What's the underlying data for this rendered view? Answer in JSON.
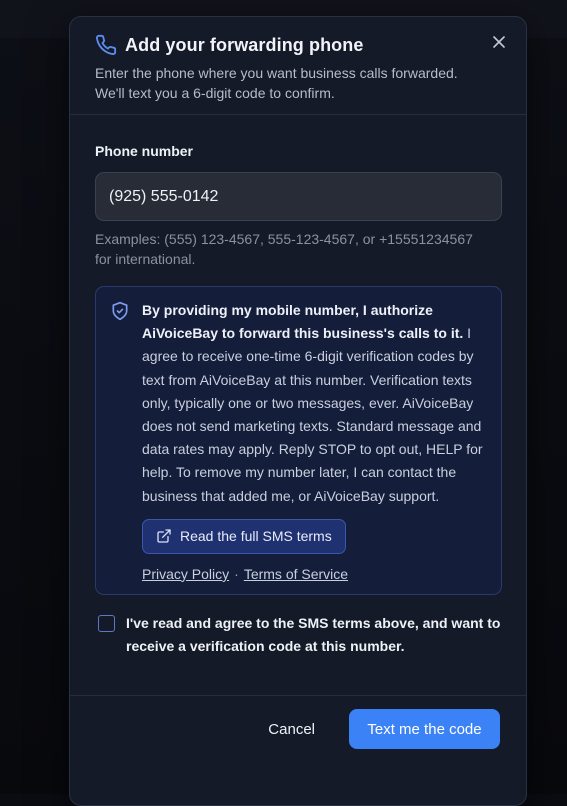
{
  "header": {
    "title": "Add your forwarding phone",
    "subtitle_line1": "Enter the phone where you want business calls forwarded.",
    "subtitle_line2": "We'll text you a 6-digit code to confirm.",
    "icon": "phone-icon",
    "close_icon": "close-icon"
  },
  "form": {
    "phone_label": "Phone number",
    "phone_value": "(925) 555-0142",
    "hint_line1": "Examples: (555) 123-4567, 555-123-4567, or +15551234567",
    "hint_line2": "for international."
  },
  "consent": {
    "icon": "shield-check-icon",
    "bold_text": "By providing my mobile number, I authorize AiVoiceBay to forward this business's calls to it.",
    "body_text": " I agree to receive one-time 6-digit verification codes by text from AiVoiceBay at this number. Verification texts only, typically one or two messages, ever. AiVoiceBay does not send marketing texts. Standard message and data rates may apply. Reply STOP to opt out, HELP for help. To remove my number later, I can contact the business that added me, or AiVoiceBay support.",
    "sms_terms_label": "Read the full SMS terms",
    "privacy_label": "Privacy Policy",
    "separator": "·",
    "terms_label": "Terms of Service"
  },
  "agree": {
    "checked": false,
    "label": "I've read and agree to the SMS terms above, and want to receive a verification code at this number."
  },
  "actions": {
    "cancel_label": "Cancel",
    "submit_label": "Text me the code"
  },
  "colors": {
    "accent": "#3b82f6",
    "modal_bg": "#141a28",
    "consent_bg": "#141d3a"
  }
}
